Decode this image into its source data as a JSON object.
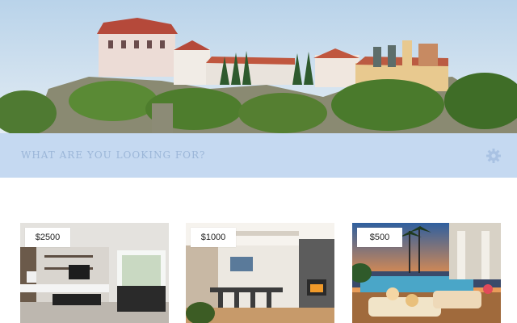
{
  "search": {
    "placeholder": "WHAT ARE YOU LOOKING FOR?",
    "settings_icon": "gear-icon"
  },
  "listings": [
    {
      "price": "$2500",
      "scene": "modern living room"
    },
    {
      "price": "$1000",
      "scene": "dining room with fireplace"
    },
    {
      "price": "$500",
      "scene": "poolside terrace at sunset"
    }
  ],
  "colors": {
    "search_bar_bg": "#c5d9f1",
    "search_text": "#9bb6d8",
    "icon": "#a9c2e3",
    "price_tag_bg": "#ffffff"
  }
}
